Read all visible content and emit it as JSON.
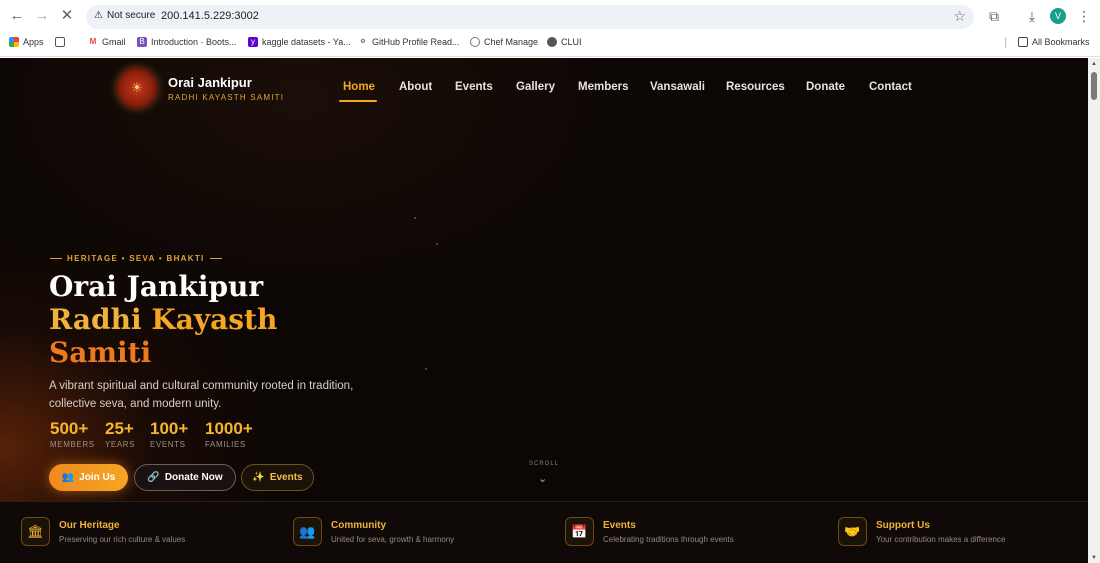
{
  "browser": {
    "security_label": "Not secure",
    "url": "200.141.5.229:3002",
    "profile_initial": "V",
    "bookmarks": [
      {
        "label": "Apps"
      },
      {
        "label": "Gmail"
      },
      {
        "label": "Introduction · Boots..."
      },
      {
        "label": "kaggle datasets - Ya..."
      },
      {
        "label": "GitHub Profile Read..."
      },
      {
        "label": "Chef Manage"
      },
      {
        "label": "CLUI"
      }
    ],
    "all_bookmarks_label": "All Bookmarks"
  },
  "site": {
    "brand_name": "Orai Jankipur",
    "brand_sub": "RADHI KAYASTH SAMITI",
    "nav": [
      "Home",
      "About",
      "Events",
      "Gallery",
      "Members",
      "Vansawali",
      "Resources",
      "Donate",
      "Contact"
    ],
    "active_nav": "Home"
  },
  "hero": {
    "kicker": "HERITAGE • SEVA • BHAKTI",
    "title_line1": "Orai Jankipur",
    "title_line2_a": "Radhi",
    "title_line2_b": "Kayasth",
    "title_line3": "Samiti",
    "lead": "A vibrant spiritual and cultural community rooted in tradition, collective seva, and modern unity.",
    "stats": [
      {
        "value": "500+",
        "label": "MEMBERS"
      },
      {
        "value": "25+",
        "label": "YEARS"
      },
      {
        "value": "100+",
        "label": "EVENTS"
      },
      {
        "value": "1000+",
        "label": "FAMILIES"
      }
    ],
    "buttons": {
      "join": "Join Us",
      "donate": "Donate Now",
      "events": "Events"
    },
    "scroll_label": "SCROLL"
  },
  "features": [
    {
      "title": "Our Heritage",
      "desc": "Preserving our rich culture & values",
      "icon": "temple-icon"
    },
    {
      "title": "Community",
      "desc": "United for seva, growth & harmony",
      "icon": "people-icon"
    },
    {
      "title": "Events",
      "desc": "Celebrating traditions through events",
      "icon": "calendar-icon"
    },
    {
      "title": "Support Us",
      "desc": "Your contribution makes a difference",
      "icon": "hand-heart-icon"
    }
  ],
  "colors": {
    "accent": "#f5a623",
    "accent_orange": "#ee7a1f",
    "background": "#0b0705"
  }
}
